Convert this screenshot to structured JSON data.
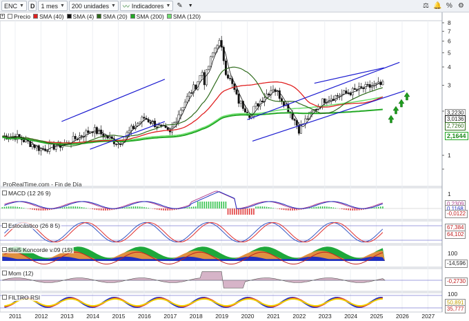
{
  "toolbar": {
    "symbol": "ENC",
    "d_button": "D",
    "timeframe": "1 mes",
    "units": "200 unidades",
    "indicators": "Indicadores"
  },
  "legend": {
    "price": "Precio",
    "sma40": "SMA (40)",
    "sma4": "SMA (4)",
    "sma20": "SMA (20)",
    "sma200": "SMA (200)",
    "sma120": "SMA (120)"
  },
  "colors": {
    "sma40": "#e02020",
    "sma4": "#111111",
    "sma20": "#2f6b1c",
    "sma200": "#22a824",
    "sma120": "#70e070",
    "channel": "#1a1ad0",
    "arrows": "#1e9c1e"
  },
  "source_note": "ProRealTime.com - Fin de Día",
  "price_axis": {
    "ticks": [
      "8",
      "7",
      "6",
      "5",
      "4",
      "3",
      "2",
      "1"
    ],
    "tags": [
      "3,2230",
      "3,0136",
      "2,7260",
      "2,1644"
    ]
  },
  "panels": {
    "macd": {
      "title": "MACD (12 26 9)",
      "scale": "1",
      "tags": [
        "0,2309",
        "0,1168",
        "-0,0122"
      ]
    },
    "stoch": {
      "title": "Estocástico (26 8 5)",
      "tags": [
        "67,384",
        "64,102"
      ]
    },
    "koncorde": {
      "title": "Blai5 Koncorde v.09 (15)",
      "scale": "100",
      "tags": [
        "-14,596"
      ]
    },
    "mom": {
      "title": "Mom (12)",
      "tags": [
        "-0,2730"
      ]
    },
    "rsi": {
      "title": "FILTRO RSI",
      "scale": "100",
      "tags": [
        "50,891",
        "35,777"
      ]
    }
  },
  "time_axis": [
    "2011",
    "2012",
    "2013",
    "2014",
    "2015",
    "2016",
    "2017",
    "2018",
    "2019",
    "2020",
    "2021",
    "2022",
    "2023",
    "2024",
    "2025",
    "2026",
    "2027"
  ],
  "chart_data": {
    "type": "candlestick",
    "x_years": [
      2011,
      2012,
      2013,
      2014,
      2015,
      2016,
      2017,
      2018,
      2019,
      2020,
      2021,
      2022,
      2023,
      2024,
      2025
    ],
    "close_approx": [
      1.35,
      1.1,
      1.2,
      1.5,
      1.2,
      1.8,
      1.4,
      3.0,
      5.8,
      1.8,
      2.9,
      1.5,
      2.4,
      2.7,
      3.01
    ],
    "yticks": [
      1,
      2,
      3,
      4,
      5,
      6,
      7,
      8
    ],
    "channels": [
      {
        "from": [
          2012.8,
          1.7
        ],
        "to": [
          2016.8,
          3.3
        ]
      },
      {
        "from": [
          2013.9,
          1.1
        ],
        "to": [
          2016.8,
          1.7
        ]
      },
      {
        "from": [
          2020.0,
          1.75
        ],
        "to": [
          2025.9,
          4.3
        ]
      },
      {
        "from": [
          2020.2,
          1.25
        ],
        "to": [
          2026.1,
          2.75
        ]
      }
    ]
  }
}
